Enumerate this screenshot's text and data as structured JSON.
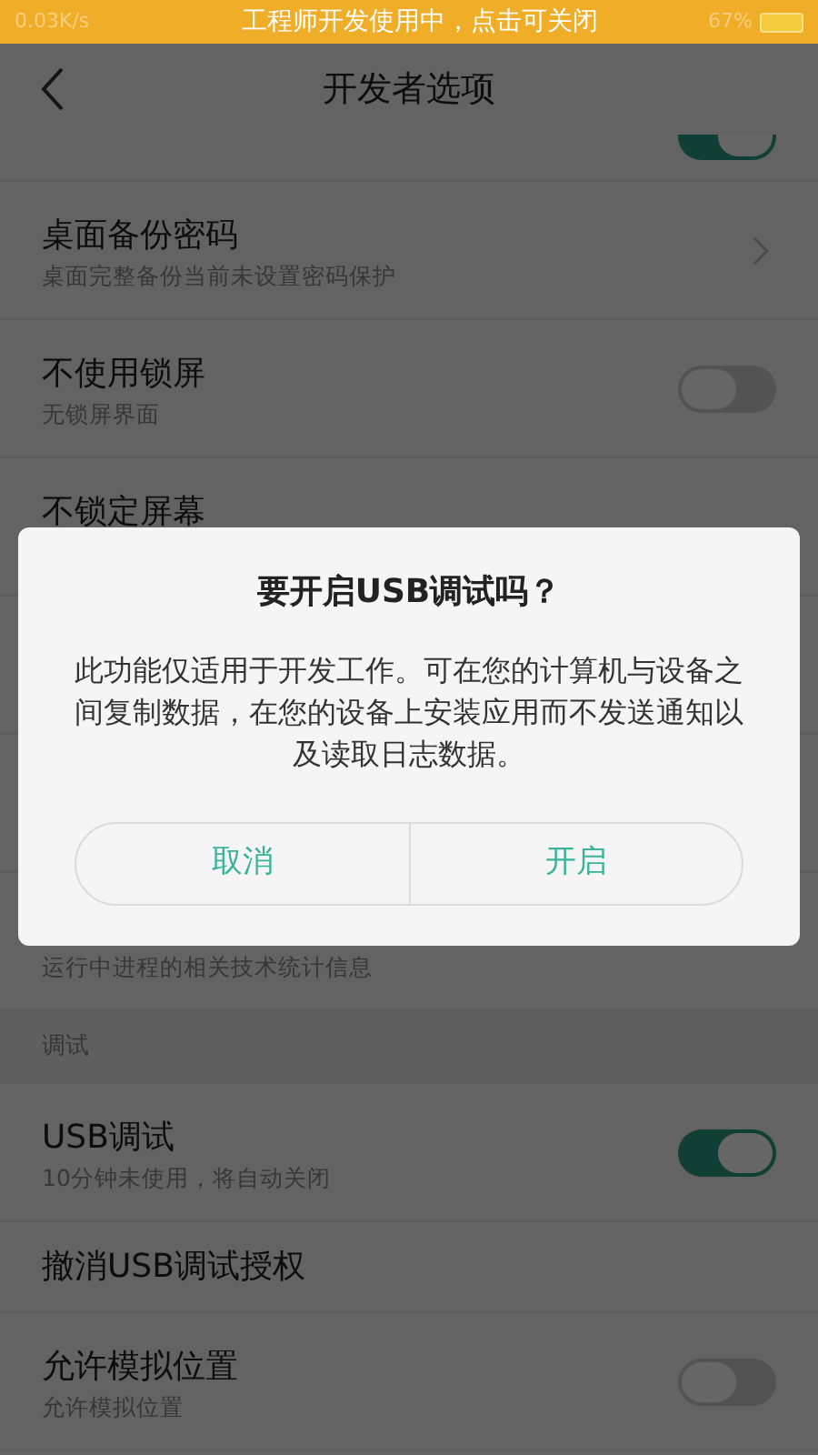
{
  "status_bar": {
    "speed": "0.03K/s",
    "battery": "67%",
    "banner": "工程师开发使用中，点击可关闭"
  },
  "header": {
    "title": "开发者选项"
  },
  "rows": [
    {
      "kind": "cut",
      "switch_on": true
    },
    {
      "kind": "two-line",
      "title": "桌面备份密码",
      "subtitle": "桌面完整备份当前未设置密码保护",
      "chevron": true
    },
    {
      "kind": "two-line",
      "title": "不使用锁屏",
      "subtitle": "无锁屏界面",
      "switch_on": false
    },
    {
      "kind": "two-line",
      "title": "不锁定屏幕"
    },
    {
      "kind": "two-line"
    },
    {
      "kind": "two-line"
    },
    {
      "kind": "two-line",
      "subtitle": "运行中进程的相关技术统计信息"
    },
    {
      "kind": "section",
      "title": "调试"
    },
    {
      "kind": "two-line",
      "title": "USB调试",
      "subtitle": "10分钟未使用，将自动关闭",
      "switch_on": true
    },
    {
      "kind": "one-line",
      "title": "撤消USB调试授权"
    },
    {
      "kind": "two-line",
      "title": "允许模拟位置",
      "subtitle": "允许模拟位置",
      "switch_on": false
    }
  ],
  "dialog": {
    "title": "要开启USB调试吗？",
    "message": "此功能仅适用于开发工作。可在您的计算机与设备之间复制数据，在您的设备上安装应用而不发送通知以及读取日志数据。",
    "buttons": [
      "取消",
      "开启"
    ]
  }
}
